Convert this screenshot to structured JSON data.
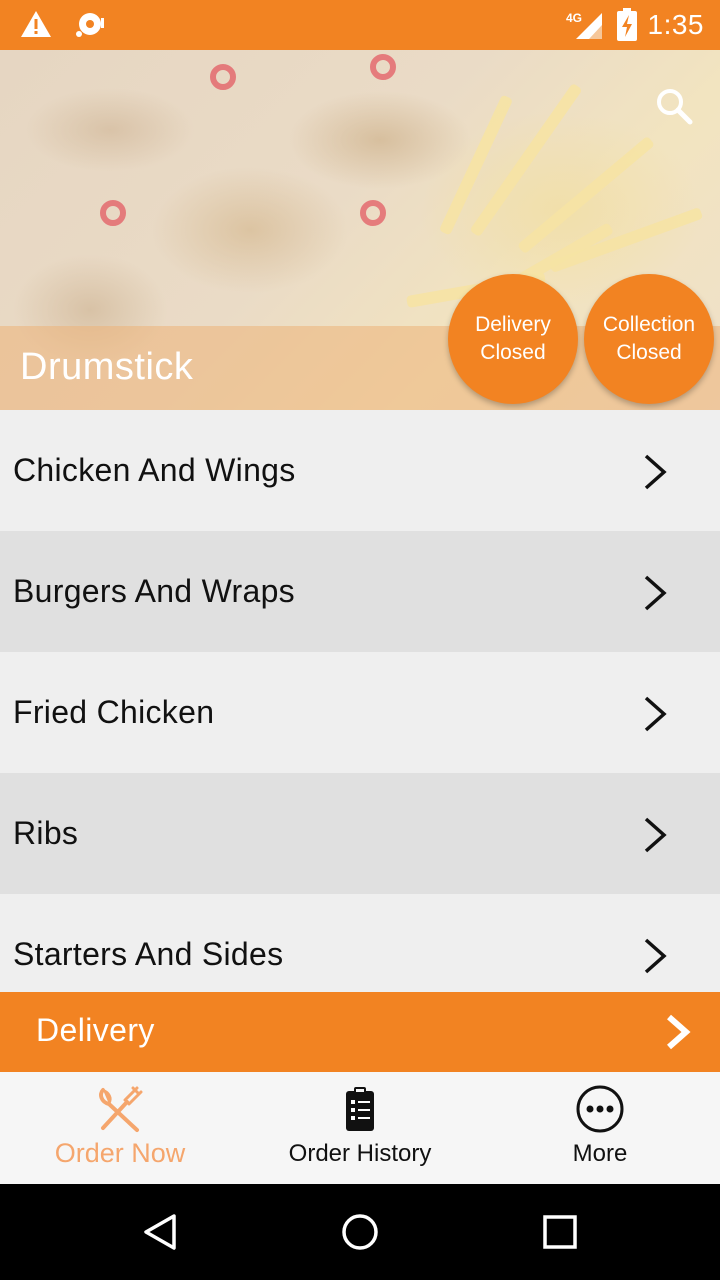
{
  "status_bar": {
    "time": "1:35",
    "network": "4G",
    "icons": [
      "warning-icon",
      "media-icon",
      "signal-icon",
      "battery-charging-icon"
    ]
  },
  "hero": {
    "title": "Drumstick",
    "search_icon": "search-icon",
    "badges": [
      {
        "line1": "Delivery",
        "line2": "Closed"
      },
      {
        "line1": "Collection",
        "line2": "Closed"
      }
    ]
  },
  "menu": {
    "items": [
      {
        "label": "Chicken And Wings"
      },
      {
        "label": "Burgers And Wraps"
      },
      {
        "label": "Fried Chicken"
      },
      {
        "label": "Ribs"
      },
      {
        "label": "Starters And Sides"
      }
    ]
  },
  "delivery_bar": {
    "label": "Delivery"
  },
  "bottom_nav": {
    "tabs": [
      {
        "label": "Order Now",
        "icon": "fork-knife-icon",
        "active": true
      },
      {
        "label": "Order History",
        "icon": "clipboard-list-icon",
        "active": false
      },
      {
        "label": "More",
        "icon": "more-dots-icon",
        "active": false
      }
    ]
  },
  "colors": {
    "accent": "#f28322",
    "active_tab": "#f5a66d",
    "row_light": "#efefef",
    "row_dark": "#e0e0e0"
  }
}
